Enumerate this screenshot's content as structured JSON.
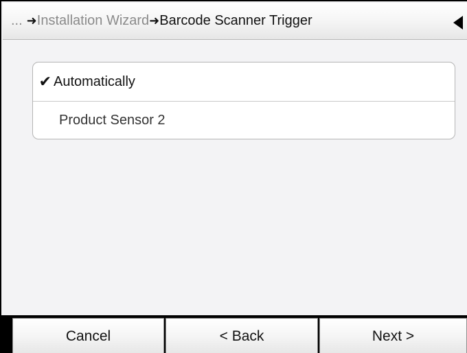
{
  "header": {
    "ellipsis": "...",
    "arrow_glyph": "➜",
    "previous_crumb": "Installation Wizard",
    "current_crumb": "Barcode Scanner Trigger",
    "back_icon": "back-triangle-icon"
  },
  "options": {
    "items": [
      {
        "label": "Automatically",
        "selected": true,
        "check": "✔"
      },
      {
        "label": "Product Sensor 2",
        "selected": false,
        "check": ""
      }
    ]
  },
  "footer": {
    "cancel_label": "Cancel",
    "back_label": "< Back",
    "next_label": "Next >"
  }
}
